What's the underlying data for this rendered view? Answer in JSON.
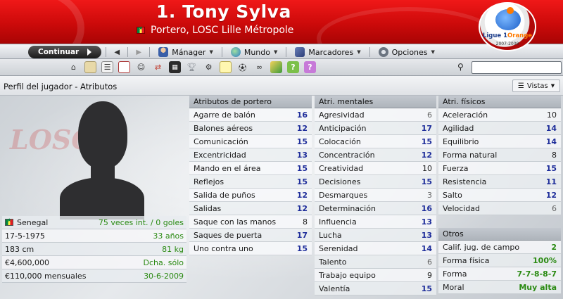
{
  "header": {
    "title": "1. Tony Sylva",
    "subtitle": "Portero, LOSC Lille Métropole",
    "league_badge": {
      "line1": "Ligue 1",
      "line1_accent": "Orange",
      "years": "2007-2008"
    }
  },
  "menubar": {
    "continue_label": "Continuar",
    "items": [
      {
        "label": "Mánager",
        "icon": "manager-icon"
      },
      {
        "label": "Mundo",
        "icon": "globe-icon"
      },
      {
        "label": "Marcadores",
        "icon": "bookmarks-icon"
      },
      {
        "label": "Opciones",
        "icon": "options-icon"
      }
    ]
  },
  "iconbar": {
    "icons": [
      "home-icon",
      "inbox-icon",
      "squad-icon",
      "calendar-icon",
      "staff-icon",
      "transfers-icon",
      "tactics-icon",
      "trophy-icon",
      "training-icon",
      "notes-icon",
      "match-icon",
      "scout-icon",
      "finances-icon",
      "help-icon",
      "info-icon"
    ],
    "search_placeholder": ""
  },
  "subheader": {
    "breadcrumb": "Perfil del jugador - Atributos",
    "views_label": "Vistas"
  },
  "profile": {
    "nation": "Senegal",
    "caps": "75 veces int. / 0 goles",
    "dob": "17-5-1975",
    "age": "33 años",
    "height": "183 cm",
    "weight": "81 kg",
    "value": "€4,600,000",
    "foot": "Dcha. sólo",
    "wage": "€110,000 mensuales",
    "contract_end": "30-6-2009",
    "club_watermark": "LOSC"
  },
  "goalkeeper": {
    "title": "Atributos de portero",
    "rows": [
      {
        "name": "Agarre de balón",
        "value": "16",
        "tier": "great"
      },
      {
        "name": "Balones aéreos",
        "value": "12",
        "tier": "good"
      },
      {
        "name": "Comunicación",
        "value": "15",
        "tier": "good"
      },
      {
        "name": "Excentricidad",
        "value": "13",
        "tier": "good"
      },
      {
        "name": "Mando en el área",
        "value": "15",
        "tier": "good"
      },
      {
        "name": "Reflejos",
        "value": "15",
        "tier": "good"
      },
      {
        "name": "Salida de puños",
        "value": "12",
        "tier": "good"
      },
      {
        "name": "Salidas",
        "value": "12",
        "tier": "good"
      },
      {
        "name": "Saque con las manos",
        "value": "8",
        "tier": "mid"
      },
      {
        "name": "Saques de puerta",
        "value": "17",
        "tier": "great"
      },
      {
        "name": "Uno contra uno",
        "value": "15",
        "tier": "good"
      }
    ]
  },
  "mental": {
    "title": "Atri. mentales",
    "rows": [
      {
        "name": "Agresividad",
        "value": "6",
        "tier": "low"
      },
      {
        "name": "Anticipación",
        "value": "17",
        "tier": "great"
      },
      {
        "name": "Colocación",
        "value": "15",
        "tier": "good"
      },
      {
        "name": "Concentración",
        "value": "12",
        "tier": "good"
      },
      {
        "name": "Creatividad",
        "value": "10",
        "tier": "mid"
      },
      {
        "name": "Decisiones",
        "value": "15",
        "tier": "good"
      },
      {
        "name": "Desmarques",
        "value": "3",
        "tier": "low"
      },
      {
        "name": "Determinación",
        "value": "16",
        "tier": "great"
      },
      {
        "name": "Influencia",
        "value": "13",
        "tier": "good"
      },
      {
        "name": "Lucha",
        "value": "13",
        "tier": "good"
      },
      {
        "name": "Serenidad",
        "value": "14",
        "tier": "good"
      },
      {
        "name": "Talento",
        "value": "6",
        "tier": "low"
      },
      {
        "name": "Trabajo equipo",
        "value": "9",
        "tier": "mid"
      },
      {
        "name": "Valentía",
        "value": "15",
        "tier": "good"
      }
    ]
  },
  "physical": {
    "title": "Atri. físicos",
    "rows": [
      {
        "name": "Aceleración",
        "value": "10",
        "tier": "mid"
      },
      {
        "name": "Agilidad",
        "value": "14",
        "tier": "good"
      },
      {
        "name": "Equilibrio",
        "value": "14",
        "tier": "good"
      },
      {
        "name": "Forma natural",
        "value": "8",
        "tier": "mid"
      },
      {
        "name": "Fuerza",
        "value": "15",
        "tier": "good"
      },
      {
        "name": "Resistencia",
        "value": "11",
        "tier": "good"
      },
      {
        "name": "Salto",
        "value": "12",
        "tier": "good"
      },
      {
        "name": "Velocidad",
        "value": "6",
        "tier": "low"
      }
    ]
  },
  "other": {
    "title": "Otros",
    "rows": [
      {
        "name": "Calif. jug. de campo",
        "value": "2"
      },
      {
        "name": "Forma física",
        "value": "100%"
      },
      {
        "name": "Forma",
        "value": "7-7-8-8-7"
      },
      {
        "name": "Moral",
        "value": "Muy alta"
      }
    ]
  },
  "colors": {
    "header_red": "#cc0a0a",
    "good_value": "#1e2d9a",
    "green_value": "#2a8a12"
  }
}
